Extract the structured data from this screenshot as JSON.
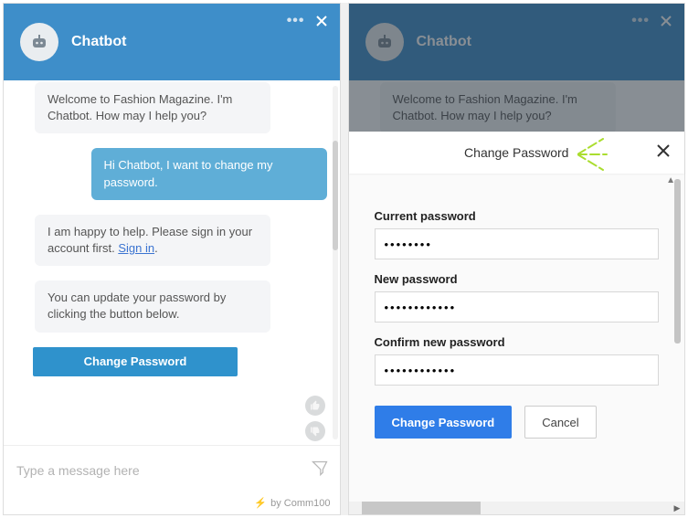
{
  "left": {
    "header": {
      "title": "Chatbot"
    },
    "messages": {
      "welcome": "Welcome to Fashion Magazine. I'm Chatbot. How may I help you?",
      "user1": "Hi Chatbot, I want to change my password.",
      "bot2_a": "I am happy to help. Please sign in your account first. ",
      "bot2_link": "Sign in",
      "bot2_b": ".",
      "bot3": "You can update your password by clicking the button below.",
      "cta": "Change Password"
    },
    "input_placeholder": "Type a message here",
    "credit": "by Comm100"
  },
  "right": {
    "header": {
      "title": "Chatbot"
    },
    "messages": {
      "welcome": "Welcome to Fashion Magazine. I'm Chatbot. How may I help you?"
    },
    "sheet": {
      "title": "Change Password",
      "current_label": "Current password",
      "current_value": "••••••••",
      "new_label": "New password",
      "new_value": "••••••••••••",
      "confirm_label": "Confirm new password",
      "confirm_value": "••••••••••••",
      "submit": "Change Password",
      "cancel": "Cancel"
    }
  }
}
